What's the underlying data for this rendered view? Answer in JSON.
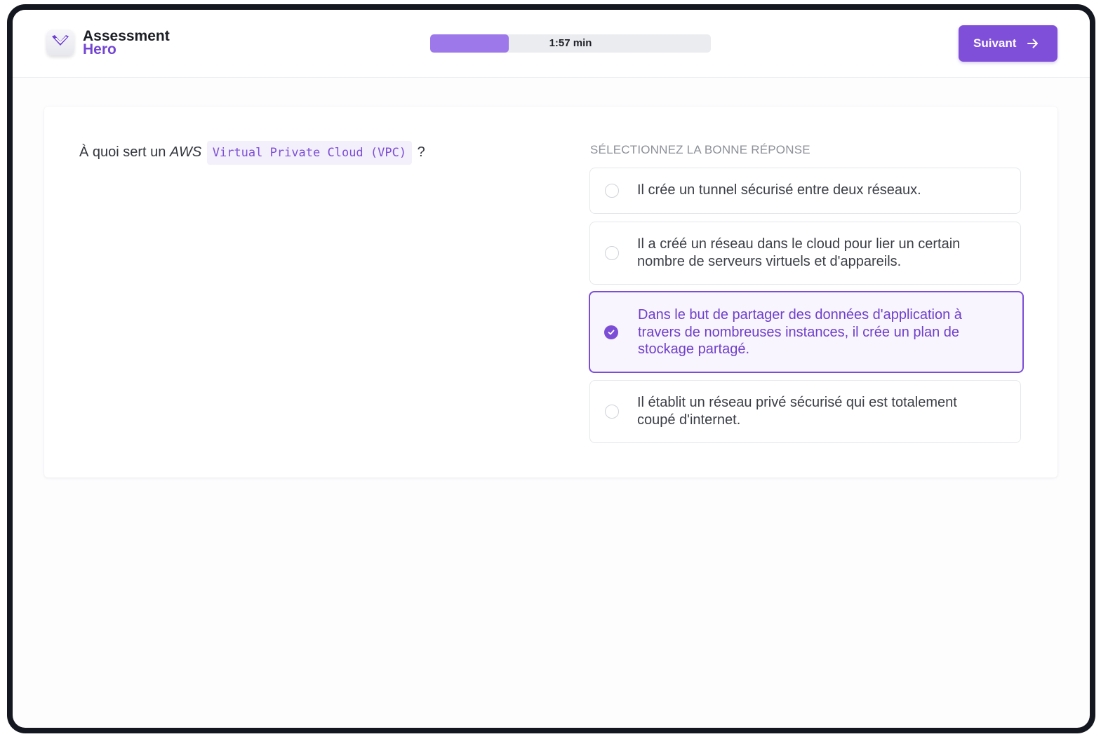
{
  "app": {
    "logo_line1": "Assessment",
    "logo_line2": "Hero",
    "logo_icon": "heart-check-icon"
  },
  "timer": {
    "label": "1:57 min",
    "elapsed_fraction": 0.28
  },
  "toolbar": {
    "next_label": "Suivant",
    "next_icon": "arrow-right-icon"
  },
  "question": {
    "prefix": "À quoi sert un ",
    "emphasis": "AWS",
    "code": "Virtual Private Cloud (VPC)",
    "suffix": "?"
  },
  "answers": {
    "title": "SÉLECTIONNEZ LA BONNE RÉPONSE",
    "options": [
      {
        "text": "Il crée un tunnel sécurisé entre deux réseaux.",
        "selected": false
      },
      {
        "text": "Il a créé un réseau dans le cloud pour lier un certain nombre de serveurs virtuels et d'appareils.",
        "selected": false
      },
      {
        "text": "Dans le but de partager des données d'application à travers de nombreuses instances, il crée un plan de stockage partagé.",
        "selected": true
      },
      {
        "text": "Il établit un réseau privé sécurisé qui est totalement coupé d'internet.",
        "selected": false
      }
    ]
  },
  "colors": {
    "accent": "#7f4fd9",
    "progress_fill": "#9d78ea",
    "selected_text": "#6f3fc9"
  }
}
